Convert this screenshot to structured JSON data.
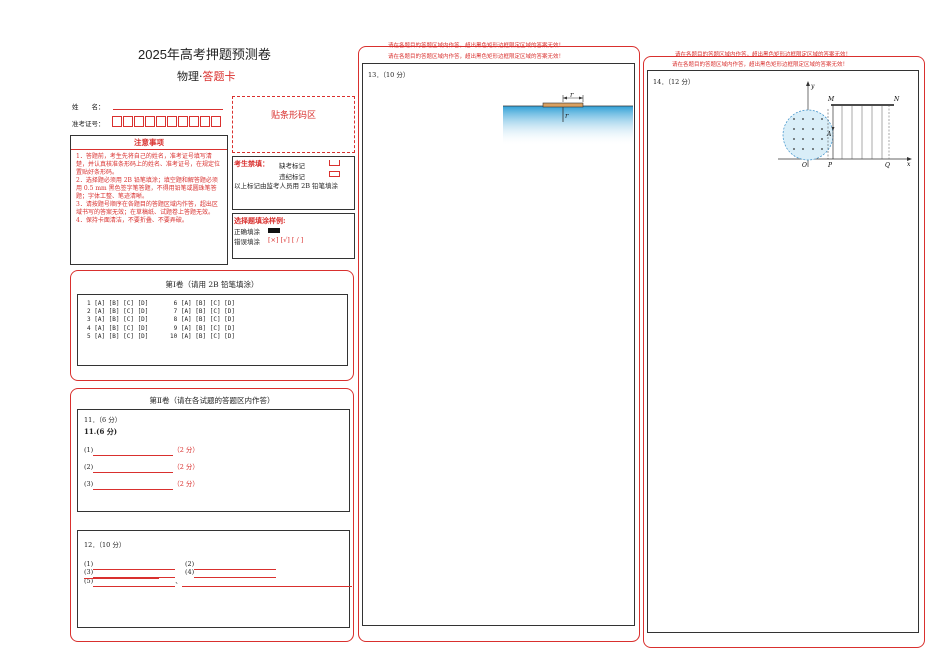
{
  "header": {
    "title": "2025年高考押题预测卷",
    "subtitle_prefix": "物理·",
    "subtitle_suffix": "答题卡"
  },
  "student": {
    "name_label": "姓　　名：",
    "id_label": "准考证号："
  },
  "barcode": {
    "label": "贴条形码区"
  },
  "notice": {
    "title": "注意事项",
    "items": [
      "1．答题前，考生先将自己的姓名，准考证号填写清楚，并认真核准条形码上的姓名、准考证号，在规定位置贴好条形码。",
      "2．选择题必须用 2B 铅笔填涂；填空题和解答题必须用 0.5 mm 黑色签字笔答题，不得用铅笔或圆珠笔答题；字体工整、笔迹清晰。",
      "3．请按题号顺序在各题目的答题区域内作答，超出区域书写的答案无效；在草稿纸、试题卷上答题无效。",
      "4．保持卡面清洁，不要折叠、不要弄破。"
    ]
  },
  "exam_status": {
    "label": "考生禁填：",
    "absent": "缺考标记",
    "violation": "违纪标记",
    "note": "以上标记由监考人员用 2B 铅笔填涂"
  },
  "fill_example": {
    "label": "选择题填涂样例:",
    "correct": "正确填涂",
    "wrong": "错误填涂",
    "wrong_marks": "[×] [√] [ / ]"
  },
  "section1": {
    "title": "第Ⅰ卷（请用 2B 铅笔填涂）",
    "rows_left": [
      "1 [A] [B] [C] [D]",
      "2 [A] [B] [C] [D]",
      "3 [A] [B] [C] [D]",
      "4 [A] [B] [C] [D]",
      "5 [A] [B] [C] [D]"
    ],
    "rows_right": [
      " 6 [A] [B] [C] [D]",
      " 7 [A] [B] [C] [D]",
      " 8 [A] [B] [C] [D]",
      " 9 [A] [B] [C] [D]",
      "10 [A] [B] [C] [D]"
    ]
  },
  "section2": {
    "title": "第Ⅱ卷（请在各试题的答题区内作答）"
  },
  "q11": {
    "header": "11．（6 分）",
    "bold_label": "11.(6 分)",
    "lines": [
      {
        "label": "(1)",
        "score": "（2 分）"
      },
      {
        "label": "(2)",
        "score": "（2 分）"
      },
      {
        "label": "(3)",
        "score": "（2 分）"
      }
    ]
  },
  "q12": {
    "header": "12．（10 分）",
    "l1": "(1)",
    "l2": "(2)",
    "l3": "(3)",
    "l4": "(4)",
    "l5": "(5)",
    "sep": "、"
  },
  "warning": "请在各题目的答题区域内作答，超出黑色矩形边框限定区域的答案无效！",
  "q13": {
    "header": "13．（10 分）",
    "fig_r_top": "r",
    "fig_r_bottom": "r"
  },
  "q14": {
    "header": "14．（12 分）",
    "fig": {
      "y": "y",
      "x": "x",
      "O": "O",
      "P": "P",
      "Q": "Q",
      "M": "M",
      "N": "N",
      "A": "A"
    }
  }
}
